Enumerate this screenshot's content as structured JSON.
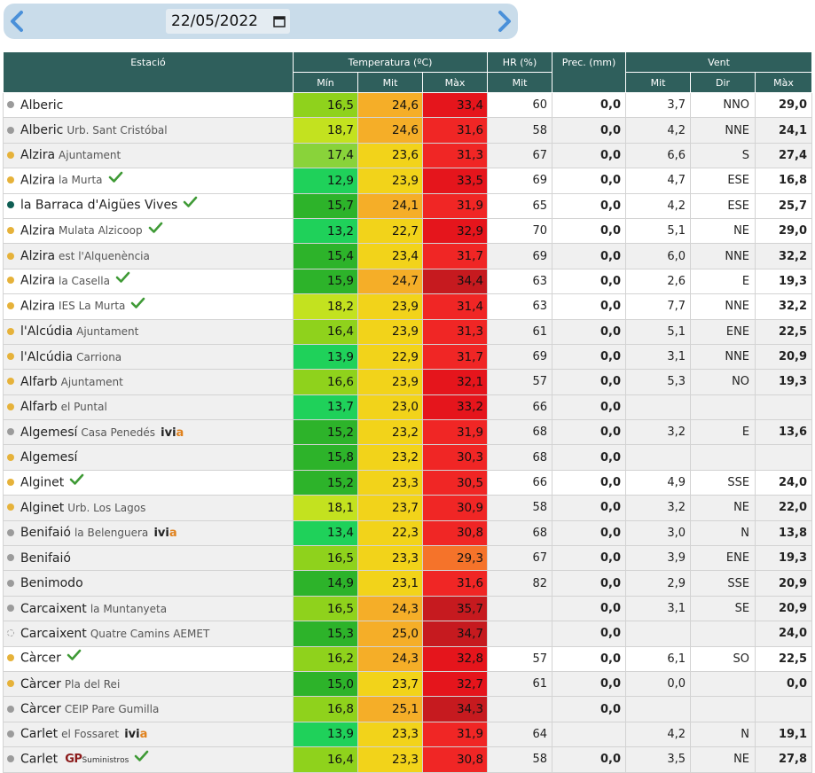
{
  "date_picker": {
    "value": "22/05/2022",
    "prev_icon": "chevron-left-icon",
    "next_icon": "chevron-right-icon",
    "calendar_icon": "calendar-icon"
  },
  "headers": {
    "station": "Estació",
    "temperature": "Temperatura (ºC)",
    "humidity": "HR (%)",
    "precipitation": "Prec. (mm)",
    "wind": "Vent",
    "temp_min": "Mín",
    "temp_avg": "Mit",
    "temp_max": "Màx",
    "hr_avg": "Mit",
    "wind_avg": "Mit",
    "wind_dir": "Dir",
    "wind_max": "Màx"
  },
  "colors": {
    "header_bg": "#2f5f5c",
    "dot_grey": "#9b9b9b",
    "dot_yellow": "#e6b23a",
    "dot_teal": "#0f5e54",
    "check": "#3f9a36"
  },
  "rows": [
    {
      "name": "Alberic",
      "sub": "",
      "dot": "grey",
      "check": false,
      "logo": "",
      "min": "16,5",
      "min_bg": "#8fd21c",
      "avg": "24,6",
      "avg_bg": "#f5ae28",
      "max": "33,4",
      "max_bg": "#e5151c",
      "hr": "60",
      "prec": "0,0",
      "wmit": "3,7",
      "wdir": "NNO",
      "wmax": "29,0",
      "white": true
    },
    {
      "name": "Alberic",
      "sub": "Urb. Sant Cristóbal",
      "dot": "grey",
      "check": false,
      "logo": "",
      "min": "18,7",
      "min_bg": "#c3e21f",
      "avg": "24,6",
      "avg_bg": "#f5ae28",
      "max": "31,6",
      "max_bg": "#f02625",
      "hr": "58",
      "prec": "0,0",
      "wmit": "4,2",
      "wdir": "NNE",
      "wmax": "24,1",
      "white": false
    },
    {
      "name": "Alzira",
      "sub": "Ajuntament",
      "dot": "yellow",
      "check": false,
      "logo": "",
      "min": "17,4",
      "min_bg": "#89d33a",
      "avg": "23,6",
      "avg_bg": "#f2d31a",
      "max": "31,3",
      "max_bg": "#f02625",
      "hr": "67",
      "prec": "0,0",
      "wmit": "6,6",
      "wdir": "S",
      "wmax": "27,4",
      "white": false
    },
    {
      "name": "Alzira",
      "sub": "la Murta",
      "dot": "yellow",
      "check": true,
      "logo": "",
      "min": "12,9",
      "min_bg": "#1fd15a",
      "avg": "23,9",
      "avg_bg": "#f2d31a",
      "max": "33,5",
      "max_bg": "#e5151c",
      "hr": "69",
      "prec": "0,0",
      "wmit": "4,7",
      "wdir": "ESE",
      "wmax": "16,8",
      "white": true
    },
    {
      "name": "la Barraca d'Aigües Vives",
      "sub": "",
      "dot": "teal",
      "check": true,
      "logo": "",
      "min": "15,7",
      "min_bg": "#2db32a",
      "avg": "24,1",
      "avg_bg": "#f5ae28",
      "max": "31,9",
      "max_bg": "#f02625",
      "hr": "65",
      "prec": "0,0",
      "wmit": "4,2",
      "wdir": "ESE",
      "wmax": "25,7",
      "white": true
    },
    {
      "name": "Alzira",
      "sub": "Mulata Alzicoop",
      "dot": "yellow",
      "check": true,
      "logo": "",
      "min": "13,2",
      "min_bg": "#1fd15a",
      "avg": "22,7",
      "avg_bg": "#f2d31a",
      "max": "32,9",
      "max_bg": "#e5151c",
      "hr": "70",
      "prec": "0,0",
      "wmit": "5,1",
      "wdir": "NE",
      "wmax": "29,0",
      "white": true
    },
    {
      "name": "Alzira",
      "sub": "est l'Alquenència",
      "dot": "yellow",
      "check": false,
      "logo": "",
      "min": "15,4",
      "min_bg": "#2db32a",
      "avg": "23,4",
      "avg_bg": "#f2d31a",
      "max": "31,7",
      "max_bg": "#f02625",
      "hr": "69",
      "prec": "0,0",
      "wmit": "6,0",
      "wdir": "NNE",
      "wmax": "32,2",
      "white": false
    },
    {
      "name": "Alzira",
      "sub": "la Casella",
      "dot": "yellow",
      "check": true,
      "logo": "",
      "min": "15,9",
      "min_bg": "#2db32a",
      "avg": "24,7",
      "avg_bg": "#f5ae28",
      "max": "34,4",
      "max_bg": "#c61a1f",
      "hr": "63",
      "prec": "0,0",
      "wmit": "2,6",
      "wdir": "E",
      "wmax": "19,3",
      "white": true
    },
    {
      "name": "Alzira",
      "sub": "IES La Murta",
      "dot": "yellow",
      "check": true,
      "logo": "",
      "min": "18,2",
      "min_bg": "#c3e21f",
      "avg": "23,9",
      "avg_bg": "#f2d31a",
      "max": "31,4",
      "max_bg": "#f02625",
      "hr": "63",
      "prec": "0,0",
      "wmit": "7,7",
      "wdir": "NNE",
      "wmax": "32,2",
      "white": true
    },
    {
      "name": "l'Alcúdia",
      "sub": "Ajuntament",
      "dot": "yellow",
      "check": false,
      "logo": "",
      "min": "16,4",
      "min_bg": "#8fd21c",
      "avg": "23,9",
      "avg_bg": "#f2d31a",
      "max": "31,3",
      "max_bg": "#f02625",
      "hr": "61",
      "prec": "0,0",
      "wmit": "5,1",
      "wdir": "ENE",
      "wmax": "22,5",
      "white": false
    },
    {
      "name": "l'Alcúdia",
      "sub": "Carriona",
      "dot": "yellow",
      "check": false,
      "logo": "",
      "min": "13,9",
      "min_bg": "#1fd15a",
      "avg": "22,9",
      "avg_bg": "#f2d31a",
      "max": "31,7",
      "max_bg": "#f02625",
      "hr": "69",
      "prec": "0,0",
      "wmit": "3,1",
      "wdir": "NNE",
      "wmax": "20,9",
      "white": false
    },
    {
      "name": "Alfarb",
      "sub": "Ajuntament",
      "dot": "yellow",
      "check": false,
      "logo": "",
      "min": "16,6",
      "min_bg": "#8fd21c",
      "avg": "23,9",
      "avg_bg": "#f2d31a",
      "max": "32,1",
      "max_bg": "#e5151c",
      "hr": "57",
      "prec": "0,0",
      "wmit": "5,3",
      "wdir": "NO",
      "wmax": "19,3",
      "white": false
    },
    {
      "name": "Alfarb",
      "sub": "el Puntal",
      "dot": "yellow",
      "check": false,
      "logo": "",
      "min": "13,7",
      "min_bg": "#1fd15a",
      "avg": "23,0",
      "avg_bg": "#f2d31a",
      "max": "33,2",
      "max_bg": "#e5151c",
      "hr": "66",
      "prec": "0,0",
      "wmit": "",
      "wdir": "",
      "wmax": "",
      "white": false
    },
    {
      "name": "Algemesí",
      "sub": "Casa Penedés",
      "dot": "grey",
      "check": false,
      "logo": "ivia",
      "min": "15,2",
      "min_bg": "#2db32a",
      "avg": "23,2",
      "avg_bg": "#f2d31a",
      "max": "31,9",
      "max_bg": "#f02625",
      "hr": "68",
      "prec": "0,0",
      "wmit": "3,2",
      "wdir": "E",
      "wmax": "13,6",
      "white": false
    },
    {
      "name": "Algemesí",
      "sub": "",
      "dot": "yellow",
      "check": false,
      "logo": "",
      "min": "15,8",
      "min_bg": "#2db32a",
      "avg": "23,2",
      "avg_bg": "#f2d31a",
      "max": "30,3",
      "max_bg": "#f02625",
      "hr": "68",
      "prec": "0,0",
      "wmit": "",
      "wdir": "",
      "wmax": "",
      "white": false
    },
    {
      "name": "Alginet",
      "sub": "",
      "dot": "yellow",
      "check": true,
      "logo": "",
      "min": "15,2",
      "min_bg": "#2db32a",
      "avg": "23,3",
      "avg_bg": "#f2d31a",
      "max": "30,5",
      "max_bg": "#f02625",
      "hr": "66",
      "prec": "0,0",
      "wmit": "4,9",
      "wdir": "SSE",
      "wmax": "24,0",
      "white": true
    },
    {
      "name": "Alginet",
      "sub": "Urb. Los Lagos",
      "dot": "yellow",
      "check": false,
      "logo": "",
      "min": "18,1",
      "min_bg": "#c3e21f",
      "avg": "23,7",
      "avg_bg": "#f2d31a",
      "max": "30,9",
      "max_bg": "#f02625",
      "hr": "58",
      "prec": "0,0",
      "wmit": "3,2",
      "wdir": "NE",
      "wmax": "22,0",
      "white": false
    },
    {
      "name": "Benifaió",
      "sub": "la Belenguera",
      "dot": "grey",
      "check": false,
      "logo": "ivia",
      "min": "13,4",
      "min_bg": "#1fd15a",
      "avg": "22,3",
      "avg_bg": "#f2d31a",
      "max": "30,8",
      "max_bg": "#f02625",
      "hr": "68",
      "prec": "0,0",
      "wmit": "3,0",
      "wdir": "N",
      "wmax": "13,8",
      "white": false
    },
    {
      "name": "Benifaió",
      "sub": "",
      "dot": "grey",
      "check": false,
      "logo": "",
      "min": "16,5",
      "min_bg": "#8fd21c",
      "avg": "23,3",
      "avg_bg": "#f2d31a",
      "max": "29,3",
      "max_bg": "#f5732a",
      "hr": "67",
      "prec": "0,0",
      "wmit": "3,9",
      "wdir": "ENE",
      "wmax": "19,3",
      "white": false
    },
    {
      "name": "Benimodo",
      "sub": "",
      "dot": "grey",
      "check": false,
      "logo": "",
      "min": "14,9",
      "min_bg": "#2db32a",
      "avg": "23,1",
      "avg_bg": "#f2d31a",
      "max": "31,6",
      "max_bg": "#f02625",
      "hr": "82",
      "prec": "0,0",
      "wmit": "2,9",
      "wdir": "SSE",
      "wmax": "20,9",
      "white": false
    },
    {
      "name": "Carcaixent",
      "sub": "la Muntanyeta",
      "dot": "grey",
      "check": false,
      "logo": "",
      "min": "16,5",
      "min_bg": "#8fd21c",
      "avg": "24,3",
      "avg_bg": "#f5ae28",
      "max": "35,7",
      "max_bg": "#c61a1f",
      "hr": "",
      "prec": "0,0",
      "wmit": "3,1",
      "wdir": "SE",
      "wmax": "20,9",
      "white": false
    },
    {
      "name": "Carcaixent",
      "sub": "Quatre Camins AEMET",
      "dot": "empty",
      "check": false,
      "logo": "",
      "min": "15,3",
      "min_bg": "#2db32a",
      "avg": "25,0",
      "avg_bg": "#f5ae28",
      "max": "34,7",
      "max_bg": "#c61a1f",
      "hr": "",
      "prec": "0,0",
      "wmit": "",
      "wdir": "",
      "wmax": "24,0",
      "white": false
    },
    {
      "name": "Càrcer",
      "sub": "",
      "dot": "yellow",
      "check": true,
      "logo": "",
      "min": "16,2",
      "min_bg": "#8fd21c",
      "avg": "24,3",
      "avg_bg": "#f5ae28",
      "max": "32,8",
      "max_bg": "#e5151c",
      "hr": "57",
      "prec": "0,0",
      "wmit": "6,1",
      "wdir": "SO",
      "wmax": "22,5",
      "white": true
    },
    {
      "name": "Càrcer",
      "sub": "Pla del Rei",
      "dot": "yellow",
      "check": false,
      "logo": "",
      "min": "15,0",
      "min_bg": "#2db32a",
      "avg": "23,7",
      "avg_bg": "#f2d31a",
      "max": "32,7",
      "max_bg": "#e5151c",
      "hr": "61",
      "prec": "0,0",
      "wmit": "0,0",
      "wdir": "",
      "wmax": "0,0",
      "white": false
    },
    {
      "name": "Càrcer",
      "sub": "CEIP Pare Gumilla",
      "dot": "grey",
      "check": false,
      "logo": "",
      "min": "16,8",
      "min_bg": "#8fd21c",
      "avg": "25,1",
      "avg_bg": "#f5ae28",
      "max": "34,3",
      "max_bg": "#c61a1f",
      "hr": "",
      "prec": "0,0",
      "wmit": "",
      "wdir": "",
      "wmax": "",
      "white": false
    },
    {
      "name": "Carlet",
      "sub": "el Fossaret",
      "dot": "grey",
      "check": false,
      "logo": "ivia",
      "min": "13,9",
      "min_bg": "#1fd15a",
      "avg": "23,3",
      "avg_bg": "#f2d31a",
      "max": "31,9",
      "max_bg": "#f02625",
      "hr": "64",
      "prec": "",
      "wmit": "4,2",
      "wdir": "N",
      "wmax": "19,1",
      "white": false
    },
    {
      "name": "Carlet",
      "sub": "",
      "dot": "grey",
      "check": true,
      "logo": "gp",
      "min": "16,4",
      "min_bg": "#8fd21c",
      "avg": "23,3",
      "avg_bg": "#f2d31a",
      "max": "30,8",
      "max_bg": "#f02625",
      "hr": "58",
      "prec": "0,0",
      "wmit": "3,5",
      "wdir": "NE",
      "wmax": "27,8",
      "white": false
    }
  ],
  "logos": {
    "ivia_main": "ivi",
    "ivia_accent": "a",
    "gp_main": "GP",
    "gp_sub": "Suministros"
  }
}
